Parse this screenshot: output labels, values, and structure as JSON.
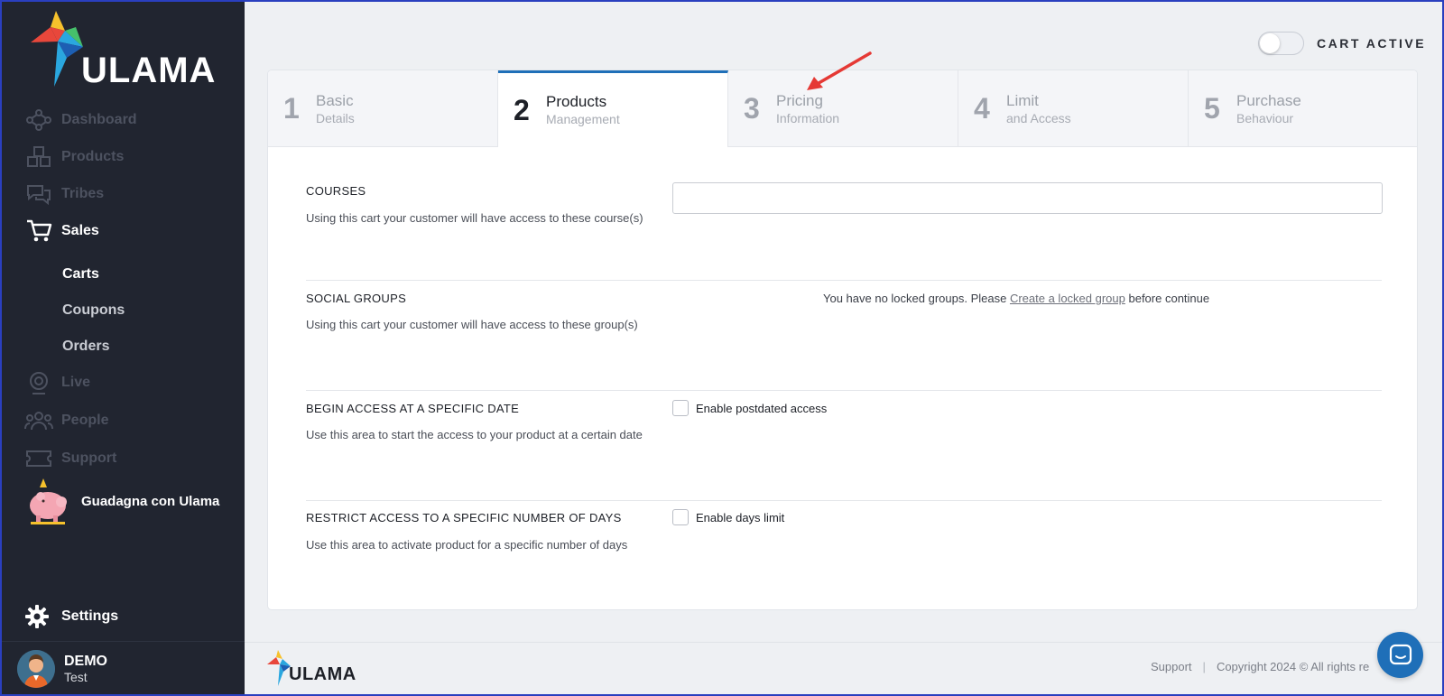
{
  "sidebar": {
    "brand": "ULAMA",
    "nav": [
      {
        "label": "Dashboard",
        "icon": "dashboard-icon",
        "active": false
      },
      {
        "label": "Products",
        "icon": "products-icon",
        "active": false
      },
      {
        "label": "Tribes",
        "icon": "tribes-icon",
        "active": false
      },
      {
        "label": "Sales",
        "icon": "cart-icon",
        "active": true
      },
      {
        "label": "Live",
        "icon": "live-icon",
        "active": false
      },
      {
        "label": "People",
        "icon": "people-icon",
        "active": false
      },
      {
        "label": "Support",
        "icon": "ticket-icon",
        "active": false
      }
    ],
    "sales_sub": [
      "Carts",
      "Coupons",
      "Orders"
    ],
    "earn_label": "Guadagna con Ulama",
    "settings_label": "Settings",
    "user": {
      "name": "DEMO",
      "role": "Test"
    }
  },
  "header": {
    "toggle_label": "CART ACTIVE",
    "toggle_on": false
  },
  "steps": [
    {
      "num": "1",
      "title": "Basic",
      "subtitle": "Details",
      "active": false
    },
    {
      "num": "2",
      "title": "Products",
      "subtitle": "Management",
      "active": true
    },
    {
      "num": "3",
      "title": "Pricing",
      "subtitle": "Information",
      "active": false
    },
    {
      "num": "4",
      "title": "Limit",
      "subtitle": "and Access",
      "active": false
    },
    {
      "num": "5",
      "title": "Purchase",
      "subtitle": "Behaviour",
      "active": false
    }
  ],
  "sections": {
    "courses": {
      "title": "COURSES",
      "desc": "Using this cart your customer will have access to these course(s)",
      "input_value": ""
    },
    "social": {
      "title": "SOCIAL GROUPS",
      "desc": "Using this cart your customer will have access to these group(s)",
      "msg_before": "You have no locked groups. Please ",
      "link": "Create a locked group",
      "msg_after": " before continue"
    },
    "begin": {
      "title": "BEGIN ACCESS AT A SPECIFIC DATE",
      "desc": "Use this area to start the access to your product at a certain date",
      "checkbox": "Enable postdated access",
      "checked": false
    },
    "restrict": {
      "title": "RESTRICT ACCESS TO A SPECIFIC NUMBER OF DAYS",
      "desc": "Use this area to activate product for a specific number of days",
      "checkbox": "Enable days limit",
      "checked": false
    }
  },
  "footer": {
    "brand": "ULAMA",
    "support": "Support",
    "copyright": "Copyright 2024 © All rights re"
  },
  "colors": {
    "sidebar_bg": "#212530",
    "accent": "#1f6fb8",
    "annotation_arrow": "#e53935"
  }
}
